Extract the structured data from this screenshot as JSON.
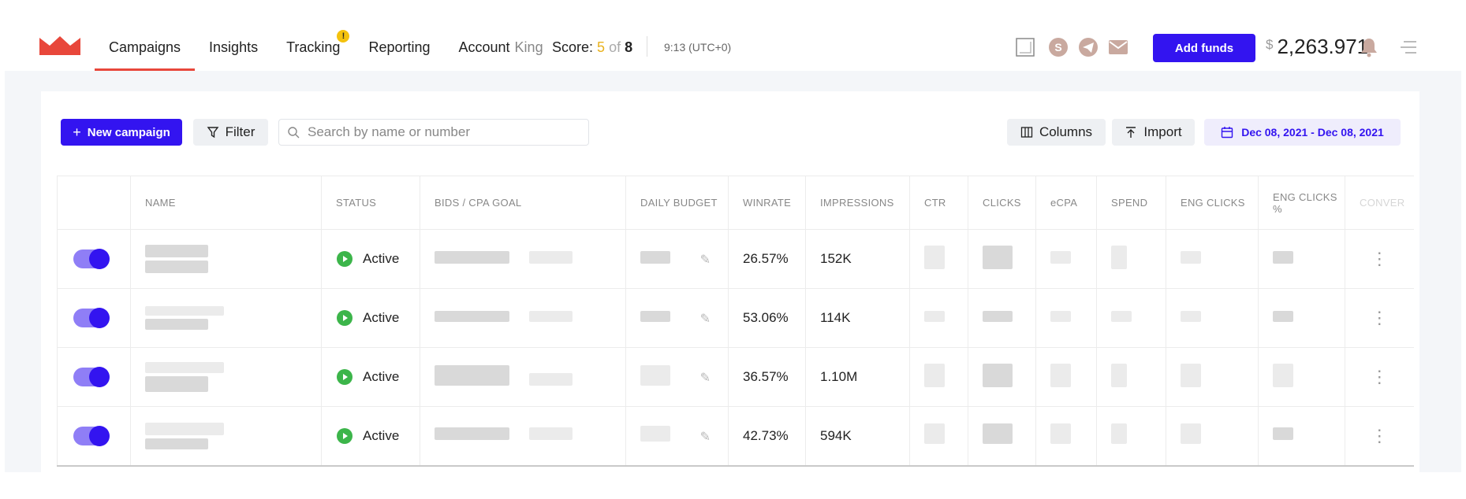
{
  "nav": {
    "items": [
      {
        "label": "Campaigns",
        "active": true
      },
      {
        "label": "Insights"
      },
      {
        "label": "Tracking",
        "badge": "!"
      },
      {
        "label": "Reporting"
      }
    ],
    "account_label": "Account",
    "account_name": "King"
  },
  "score": {
    "label": "Score:",
    "value": "5",
    "of": "of",
    "total": "8"
  },
  "time": "9:13 (UTC+0)",
  "top_icons": [
    "square-icon",
    "skype-icon",
    "telegram-icon",
    "mail-icon",
    "bell-icon",
    "menu-icon"
  ],
  "add_funds_label": "Add funds",
  "balance": {
    "currency": "$",
    "amount": "2,263.971"
  },
  "toolbar": {
    "new_campaign_label": "New campaign",
    "filter_label": "Filter",
    "search_placeholder": "Search by name or number",
    "columns_label": "Columns",
    "import_label": "Import",
    "date_range": "Dec 08, 2021 - Dec 08, 2021"
  },
  "table": {
    "headers": [
      "",
      "NAME",
      "STATUS",
      "BIDS / CPA GOAL",
      "DAILY BUDGET",
      "WINRATE",
      "IMPRESSIONS",
      "CTR",
      "CLICKS",
      "eCPA",
      "SPEND",
      "ENG CLICKS",
      "ENG CLICKS %",
      "CONVER"
    ],
    "rows": [
      {
        "status": "Active",
        "winrate": "26.57%",
        "impressions": "152K"
      },
      {
        "status": "Active",
        "winrate": "53.06%",
        "impressions": "114K"
      },
      {
        "status": "Active",
        "winrate": "36.57%",
        "impressions": "1.10M"
      },
      {
        "status": "Active",
        "winrate": "42.73%",
        "impressions": "594K"
      }
    ]
  },
  "colors": {
    "accent": "#3314f0",
    "active_tab": "#e8473b",
    "status_active": "#3cb54a",
    "badge": "#f4c20d",
    "logo": "#e8473b"
  }
}
